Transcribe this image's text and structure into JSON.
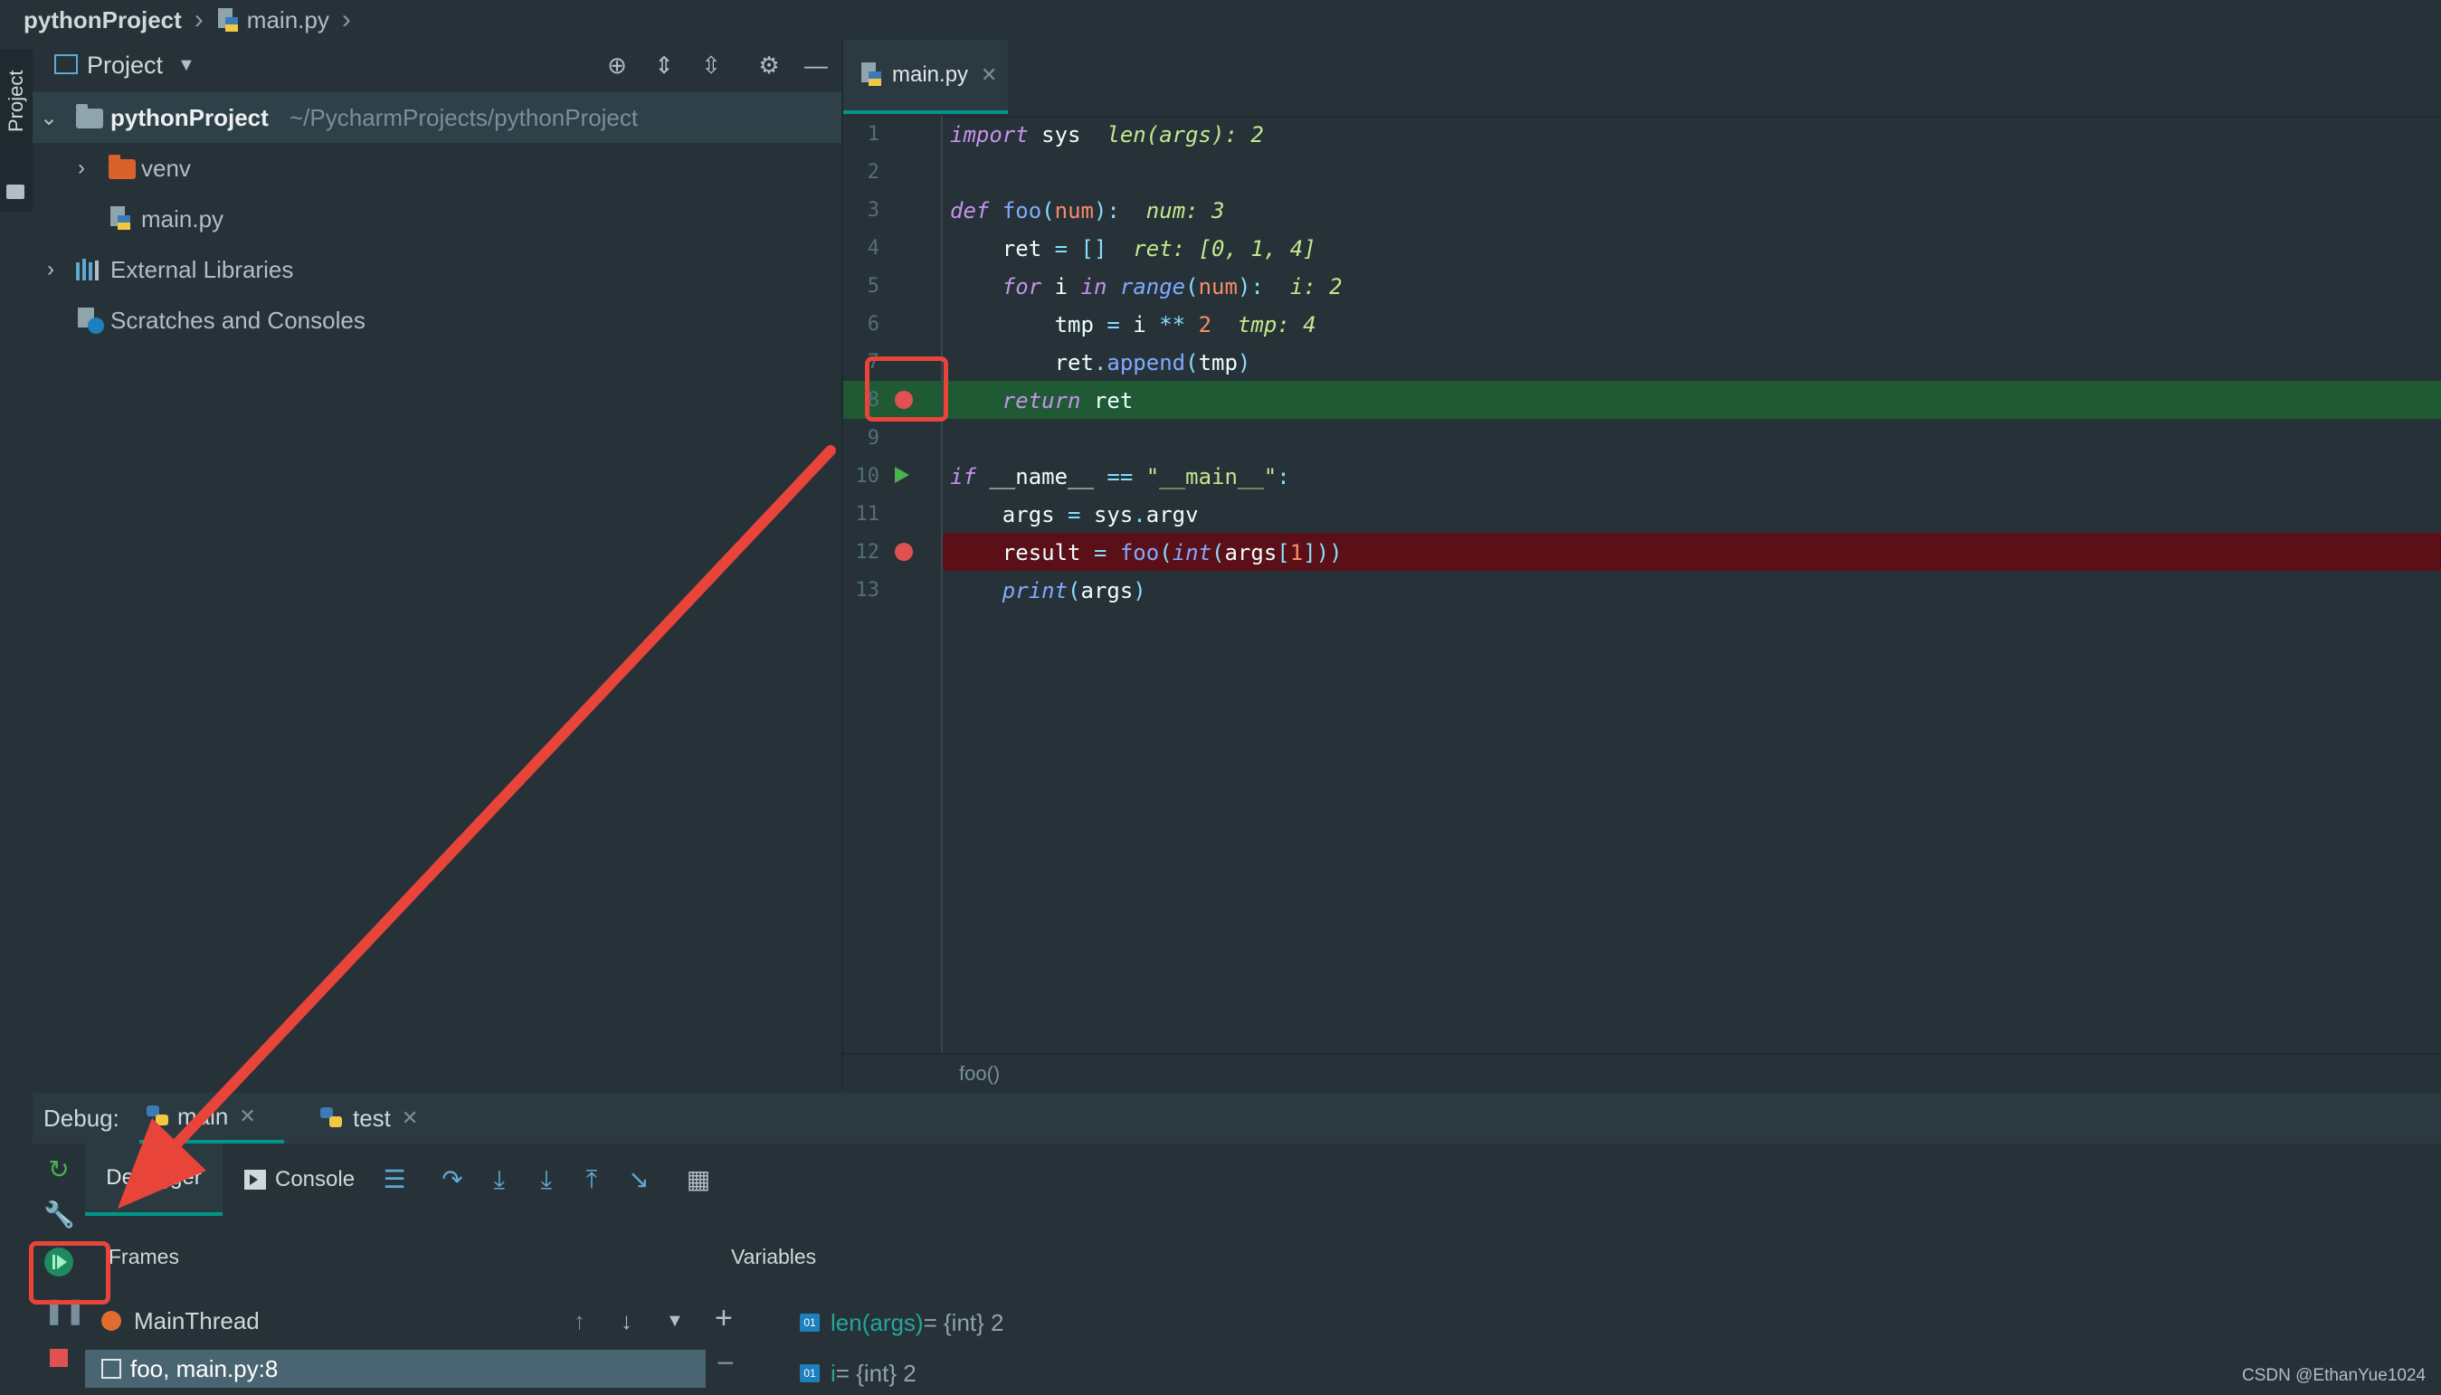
{
  "breadcrumb": {
    "project": "pythonProject",
    "file": "main.py"
  },
  "sidebar_tab": "Project",
  "project_panel": {
    "title": "Project",
    "tree": [
      {
        "label": "pythonProject",
        "path": "~/PycharmProjects/pythonProject"
      },
      {
        "label": "venv"
      },
      {
        "label": "main.py"
      },
      {
        "label": "External Libraries"
      },
      {
        "label": "Scratches and Consoles"
      }
    ]
  },
  "editor": {
    "tab": "main.py",
    "line_numbers": [
      "1",
      "2",
      "3",
      "4",
      "5",
      "6",
      "7",
      "8",
      "9",
      "10",
      "11",
      "12",
      "13"
    ],
    "hints": {
      "l1": "len(args): 2",
      "l3": "num: 3",
      "l4": "ret: [0, 1, 4]",
      "l5": "i: 2",
      "l6": "tmp: 4"
    },
    "breadcrumb_status": "foo()"
  },
  "debug": {
    "label": "Debug:",
    "tabs": [
      {
        "label": "main"
      },
      {
        "label": "test"
      }
    ],
    "subtabs": {
      "debugger": "Debugger",
      "console": "Console"
    },
    "frames_header": "Frames",
    "variables_header": "Variables",
    "thread": "MainThread",
    "selected_frame": "foo, main.py:8",
    "variables": [
      {
        "name": "len(args)",
        "value": " = {int} 2"
      },
      {
        "name": "i",
        "value": " = {int} 2"
      }
    ]
  },
  "watermark": "CSDN @EthanYue1024",
  "colors": {
    "accent": "#009688",
    "breakpoint": "#e05252",
    "annotation": "#e8443a",
    "current_line": "#1f5a35",
    "break_line": "#5b1018"
  }
}
